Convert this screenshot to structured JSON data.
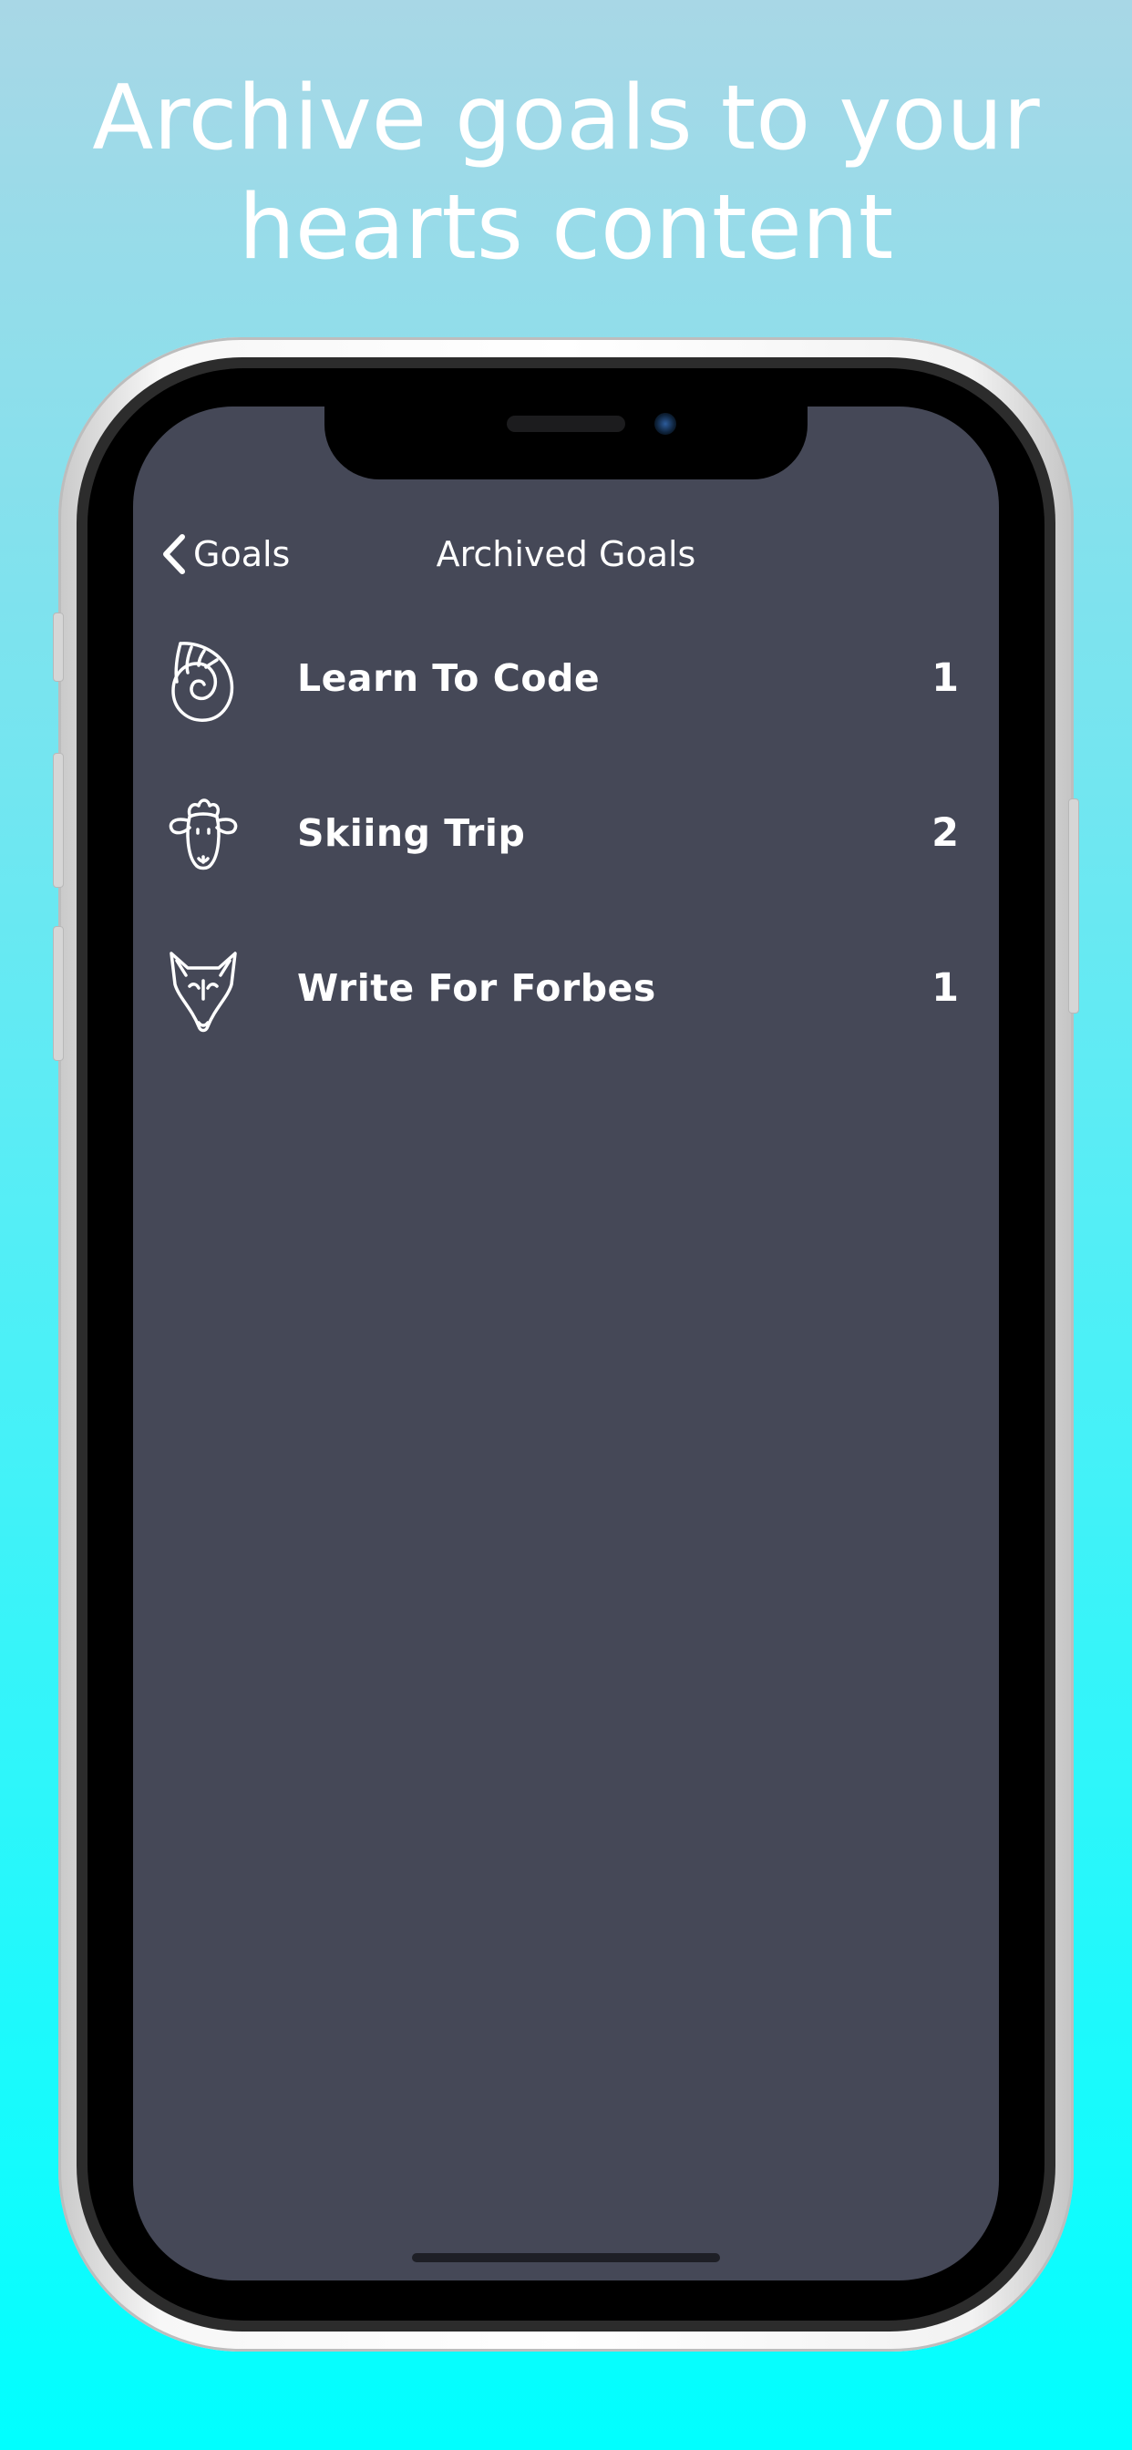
{
  "headline": {
    "line1": "Archive goals to your",
    "line2": "hearts content"
  },
  "colors": {
    "screen_background": "#454857",
    "text": "#ffffff",
    "backdrop_top": "#a8d7e6",
    "backdrop_bottom": "#00ffff"
  },
  "nav": {
    "back_label": "Goals",
    "back_icon": "chevron-left-icon",
    "title": "Archived Goals"
  },
  "goals": [
    {
      "icon": "nautilus-shell-icon",
      "name": "Learn To Code",
      "count": "1"
    },
    {
      "icon": "sheep-icon",
      "name": "Skiing Trip",
      "count": "2"
    },
    {
      "icon": "fox-icon",
      "name": "Write For Forbes",
      "count": "1"
    }
  ]
}
